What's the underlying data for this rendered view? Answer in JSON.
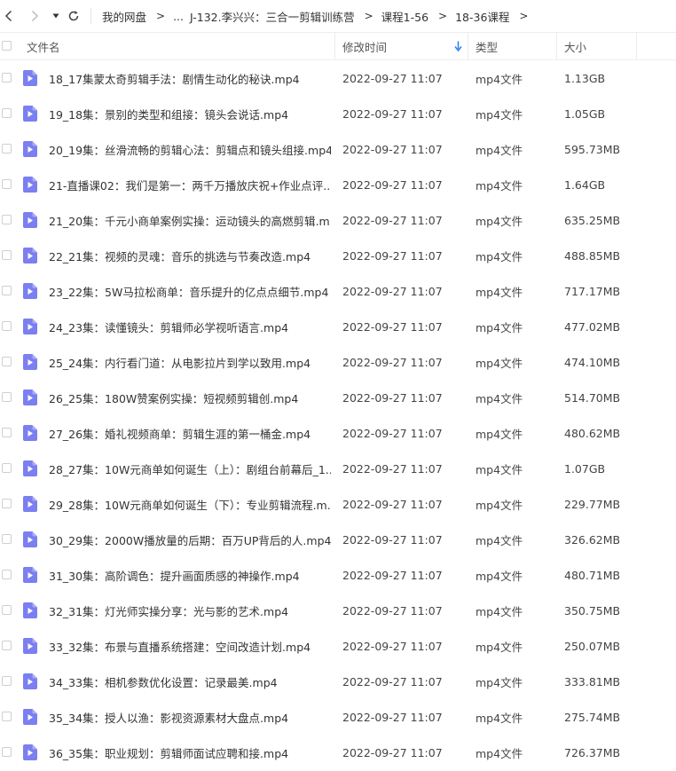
{
  "breadcrumb": [
    "我的网盘",
    "...",
    "J-132.李兴兴：三合一剪辑训练营",
    "课程1-56",
    "18-36课程"
  ],
  "breadcrumb_separator": ">",
  "columns": {
    "name": "文件名",
    "modified": "修改时间",
    "type": "类型",
    "size": "大小"
  },
  "files": [
    {
      "name": "18_17集蒙太奇剪辑手法：剧情生动化的秘诀.mp4",
      "modified": "2022-09-27 11:07",
      "type": "mp4文件",
      "size": "1.13GB"
    },
    {
      "name": "19_18集：景别的类型和组接：镜头会说话.mp4",
      "modified": "2022-09-27 11:07",
      "type": "mp4文件",
      "size": "1.05GB"
    },
    {
      "name": "20_19集：丝滑流畅的剪辑心法：剪辑点和镜头组接.mp4",
      "modified": "2022-09-27 11:07",
      "type": "mp4文件",
      "size": "595.73MB"
    },
    {
      "name": "21-直播课02：我们是第一：两千万播放庆祝+作业点评....",
      "modified": "2022-09-27 11:07",
      "type": "mp4文件",
      "size": "1.64GB"
    },
    {
      "name": "21_20集：千元小商单案例实操：运动镜头的高燃剪辑.m...",
      "modified": "2022-09-27 11:07",
      "type": "mp4文件",
      "size": "635.25MB"
    },
    {
      "name": "22_21集：视频的灵魂：音乐的挑选与节奏改造.mp4",
      "modified": "2022-09-27 11:07",
      "type": "mp4文件",
      "size": "488.85MB"
    },
    {
      "name": "23_22集：5W马拉松商单：音乐提升的亿点点细节.mp4",
      "modified": "2022-09-27 11:07",
      "type": "mp4文件",
      "size": "717.17MB"
    },
    {
      "name": "24_23集：读懂镜头：剪辑师必学视听语言.mp4",
      "modified": "2022-09-27 11:07",
      "type": "mp4文件",
      "size": "477.02MB"
    },
    {
      "name": "25_24集：内行看门道：从电影拉片到学以致用.mp4",
      "modified": "2022-09-27 11:07",
      "type": "mp4文件",
      "size": "474.10MB"
    },
    {
      "name": "26_25集：180W赞案例实操：短视频剪辑创.mp4",
      "modified": "2022-09-27 11:07",
      "type": "mp4文件",
      "size": "514.70MB"
    },
    {
      "name": "27_26集：婚礼视频商单：剪辑生涯的第一桶金.mp4",
      "modified": "2022-09-27 11:07",
      "type": "mp4文件",
      "size": "480.62MB"
    },
    {
      "name": "28_27集：10W元商单如何诞生（上）：剧组台前幕后_1....",
      "modified": "2022-09-27 11:07",
      "type": "mp4文件",
      "size": "1.07GB"
    },
    {
      "name": "29_28集：10W元商单如何诞生（下）：专业剪辑流程.m...",
      "modified": "2022-09-27 11:07",
      "type": "mp4文件",
      "size": "229.77MB"
    },
    {
      "name": "30_29集：2000W播放量的后期：百万UP背后的人.mp4",
      "modified": "2022-09-27 11:07",
      "type": "mp4文件",
      "size": "326.62MB"
    },
    {
      "name": "31_30集：高阶调色：提升画面质感的神操作.mp4",
      "modified": "2022-09-27 11:07",
      "type": "mp4文件",
      "size": "480.71MB"
    },
    {
      "name": "32_31集：灯光师实操分享：光与影的艺术.mp4",
      "modified": "2022-09-27 11:07",
      "type": "mp4文件",
      "size": "350.75MB"
    },
    {
      "name": "33_32集：布景与直播系统搭建：空间改造计划.mp4",
      "modified": "2022-09-27 11:07",
      "type": "mp4文件",
      "size": "250.07MB"
    },
    {
      "name": "34_33集：相机参数优化设置：记录最美.mp4",
      "modified": "2022-09-27 11:07",
      "type": "mp4文件",
      "size": "333.81MB"
    },
    {
      "name": "35_34集：授人以渔：影视资源素材大盘点.mp4",
      "modified": "2022-09-27 11:07",
      "type": "mp4文件",
      "size": "275.74MB"
    },
    {
      "name": "36_35集：职业规划：剪辑师面试应聘和接.mp4",
      "modified": "2022-09-27 11:07",
      "type": "mp4文件",
      "size": "726.37MB"
    }
  ],
  "icons": {
    "back": "chevron-left-icon",
    "forward": "chevron-right-icon",
    "history": "caret-down-icon",
    "refresh": "refresh-icon",
    "sort": "sort-desc-arrow-icon",
    "file": "video-file-icon"
  },
  "colors": {
    "accent": "#2b7cf6",
    "file_icon": "#7b7ff0",
    "file_icon_play": "#ffffff"
  }
}
